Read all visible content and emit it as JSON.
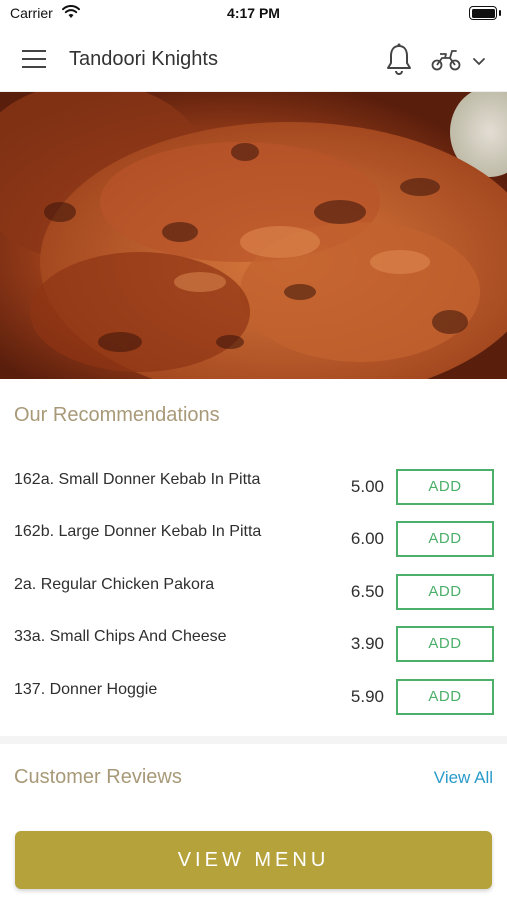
{
  "status_bar": {
    "carrier": "Carrier",
    "time": "4:17 PM"
  },
  "header": {
    "title": "Tandoori Knights",
    "icons": [
      "menu-icon",
      "bell-icon",
      "scooter-icon",
      "chevron-down-icon"
    ]
  },
  "hero": {
    "image": "grilled tandoori chicken"
  },
  "recommendations": {
    "title": "Our Recommendations",
    "add_label": "ADD",
    "items": [
      {
        "name": "162a. Small Donner Kebab In Pitta",
        "price": "5.00"
      },
      {
        "name": "162b. Large Donner Kebab In Pitta",
        "price": "6.00"
      },
      {
        "name": "2a. Regular Chicken Pakora",
        "price": "6.50"
      },
      {
        "name": "33a. Small Chips And Cheese",
        "price": "3.90"
      },
      {
        "name": "137. Donner Hoggie",
        "price": "5.90"
      }
    ]
  },
  "reviews": {
    "title": "Customer Reviews",
    "view_all": "View All"
  },
  "footer": {
    "view_menu": "VIEW MENU"
  },
  "colors": {
    "accent_gold": "#b5a23a",
    "section_title": "#a89a78",
    "add_green": "#4caf6a",
    "link_blue": "#2a9bc9"
  }
}
